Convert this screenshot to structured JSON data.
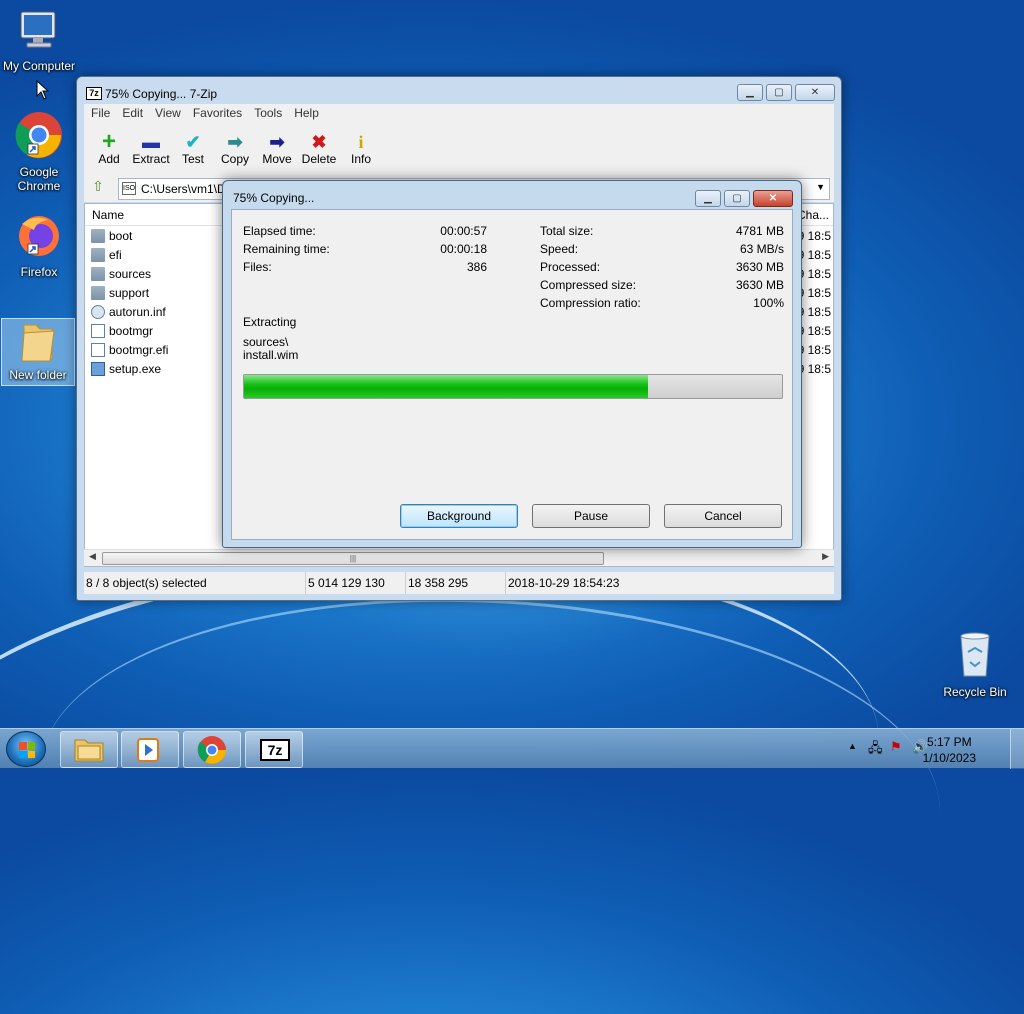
{
  "desktop": {
    "icons": [
      {
        "label": "My Computer"
      },
      {
        "label": "Google Chrome"
      },
      {
        "label": "Firefox"
      },
      {
        "label": "New folder"
      },
      {
        "label": "Recycle Bin"
      }
    ]
  },
  "main_window": {
    "title": "75% Copying... 7-Zip",
    "app_icon_text": "7z",
    "menu": [
      "File",
      "Edit",
      "View",
      "Favorites",
      "Tools",
      "Help"
    ],
    "toolbar": [
      {
        "label": "Add",
        "icon": "+",
        "color": "#1ba81b"
      },
      {
        "label": "Extract",
        "icon": "▬",
        "color": "#2433a8"
      },
      {
        "label": "Test",
        "icon": "✔",
        "color": "#1fb3c7"
      },
      {
        "label": "Copy",
        "icon": "➡",
        "color": "#2b8a8a"
      },
      {
        "label": "Move",
        "icon": "➡",
        "color": "#1b1f8a"
      },
      {
        "label": "Delete",
        "icon": "✖",
        "color": "#d01818"
      },
      {
        "label": "Info",
        "icon": "i",
        "color": "#c9a800"
      }
    ],
    "path": "C:\\Users\\vm1\\D",
    "path_icon": "ISO",
    "columns": {
      "name": "Name",
      "changed": "Cha..."
    },
    "files": [
      {
        "name": "boot",
        "type": "folder",
        "changed": "9 18:5"
      },
      {
        "name": "efi",
        "type": "folder",
        "changed": "9 18:5"
      },
      {
        "name": "sources",
        "type": "folder",
        "changed": "9 18:5"
      },
      {
        "name": "support",
        "type": "folder",
        "changed": "9 18:5"
      },
      {
        "name": "autorun.inf",
        "type": "inf",
        "changed": "9 18:5"
      },
      {
        "name": "bootmgr",
        "type": "file",
        "changed": "9 18:5"
      },
      {
        "name": "bootmgr.efi",
        "type": "file",
        "changed": "9 18:5"
      },
      {
        "name": "setup.exe",
        "type": "exe",
        "changed": "9 18:5"
      }
    ],
    "status": {
      "selected": "8 / 8 object(s) selected",
      "size": "5 014 129 130",
      "packed": "18 358 295",
      "date": "2018-10-29 18:54:23"
    }
  },
  "dialog": {
    "title": "75% Copying...",
    "elapsed_label": "Elapsed time:",
    "elapsed": "00:00:57",
    "remaining_label": "Remaining time:",
    "remaining": "00:00:18",
    "files_label": "Files:",
    "files": "386",
    "total_label": "Total size:",
    "total": "4781 MB",
    "speed_label": "Speed:",
    "speed": "63 MB/s",
    "processed_label": "Processed:",
    "processed": "3630 MB",
    "compressed_label": "Compressed size:",
    "compressed": "3630 MB",
    "ratio_label": "Compression ratio:",
    "ratio": "100%",
    "operation": "Extracting",
    "current_path": "sources\\",
    "current_file": "install.wim",
    "progress_fraction": 0.75,
    "buttons": {
      "background": "Background",
      "pause": "Pause",
      "cancel": "Cancel"
    }
  },
  "taskbar": {
    "time": "5:17 PM",
    "date": "1/10/2023",
    "app_7z_text": "7z"
  }
}
